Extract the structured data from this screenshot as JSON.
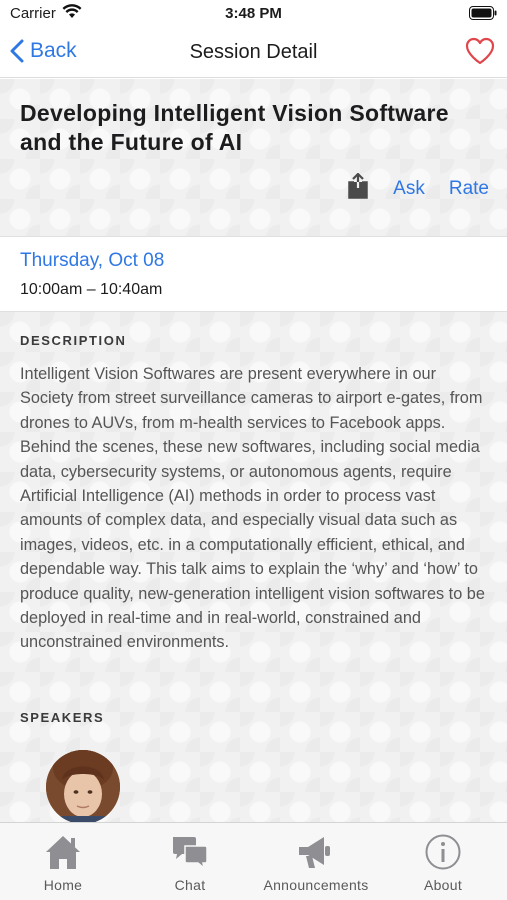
{
  "status_bar": {
    "carrier": "Carrier",
    "time": "3:48 PM"
  },
  "nav": {
    "back_label": "Back",
    "title": "Session Detail"
  },
  "session": {
    "title": "Developing Intelligent Vision Software and the Future of AI",
    "actions": {
      "ask_label": "Ask",
      "rate_label": "Rate"
    },
    "date": "Thursday, Oct 08",
    "time_range": "10:00am – 10:40am",
    "description_label": "DESCRIPTION",
    "description": "Intelligent Vision Softwares are present everywhere in our Society from street surveillance cameras to airport e-gates, from drones to AUVs, from m-health services to Facebook apps. Behind the scenes, these new softwares, including social media data, cybersecurity systems, or autonomous agents, require Artificial Intelligence (AI) methods in order to process vast amounts of complex data, and especially visual data such as images, videos, etc. in a computationally efficient, ethical, and dependable way. This talk aims to explain the ‘why’ and ‘how’ to produce quality, new-generation intelligent vision softwares to be deployed in real-time and in real-world, constrained and unconstrained environments.",
    "speakers_label": "SPEAKERS"
  },
  "tab_bar": {
    "tabs": [
      {
        "label": "Home",
        "icon": "home-icon"
      },
      {
        "label": "Chat",
        "icon": "chat-icon"
      },
      {
        "label": "Announcements",
        "icon": "megaphone-icon"
      },
      {
        "label": "About",
        "icon": "info-icon"
      }
    ]
  },
  "colors": {
    "accent": "#2f78e4",
    "heart": "#e0474c",
    "tab_icon": "#8e8e93"
  }
}
